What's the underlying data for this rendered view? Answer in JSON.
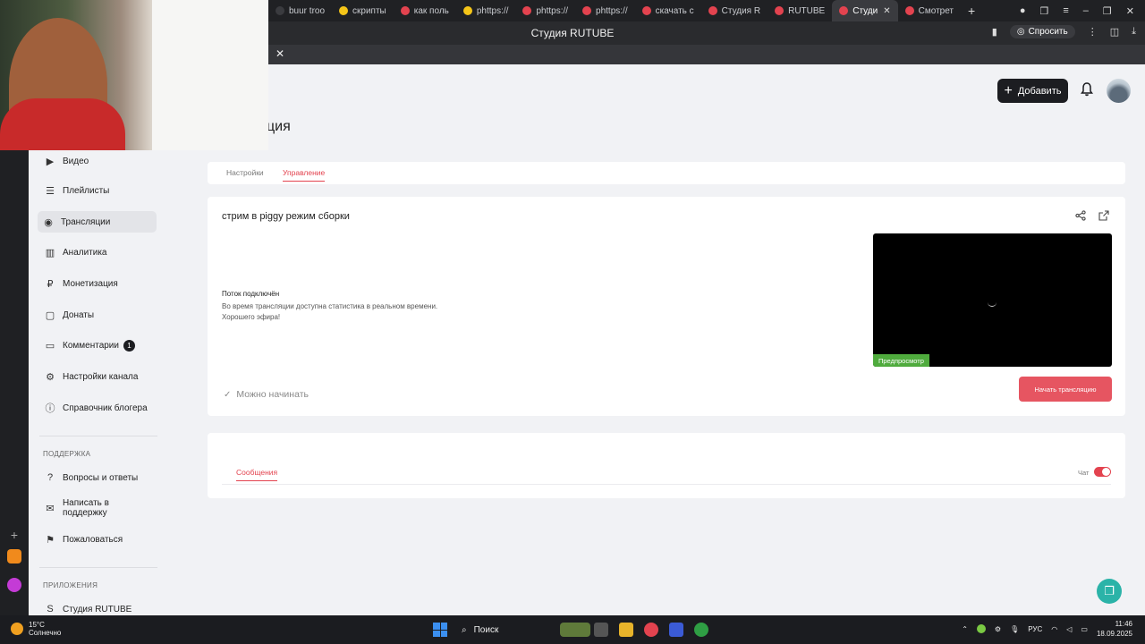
{
  "browser": {
    "tabs": [
      {
        "label": "buur troo",
        "favicon_color": "#3a3b3f"
      },
      {
        "label": "скрипты",
        "favicon_color": "#f5c518"
      },
      {
        "label": "как поль",
        "favicon_color": "#e3434f"
      },
      {
        "label": "phttps://",
        "favicon_color": "#f5c518"
      },
      {
        "label": "phttps://",
        "favicon_color": "#e3434f"
      },
      {
        "label": "phttps://",
        "favicon_color": "#e3434f"
      },
      {
        "label": "скачать с",
        "favicon_color": "#e3434f"
      },
      {
        "label": "Студия R",
        "favicon_color": "#e3434f"
      },
      {
        "label": "RUTUBE",
        "favicon_color": "#e3434f"
      },
      {
        "label": "Студи",
        "favicon_color": "#e3434f",
        "active": true
      },
      {
        "label": "Смотрет",
        "favicon_color": "#e3434f"
      }
    ],
    "page_title": "Студия RUTUBE",
    "ask_label": "Спросить"
  },
  "header": {
    "page_title_fragment": "ция",
    "add_label": "Добавить"
  },
  "sidebar": {
    "items": [
      {
        "label": "Видео",
        "icon": "video-icon",
        "glyph": "▶"
      },
      {
        "label": "Плейлисты",
        "icon": "playlist-icon",
        "glyph": "☰"
      },
      {
        "label": "Трансляции",
        "icon": "broadcast-icon",
        "glyph": "◉",
        "active": true
      },
      {
        "label": "Аналитика",
        "icon": "analytics-icon",
        "glyph": "▥"
      },
      {
        "label": "Монетизация",
        "icon": "monetization-icon",
        "glyph": "₽"
      },
      {
        "label": "Донаты",
        "icon": "donate-icon",
        "glyph": "▢"
      },
      {
        "label": "Комментарии",
        "icon": "comments-icon",
        "glyph": "▭",
        "badge": "1"
      },
      {
        "label": "Настройки канала",
        "icon": "gear-icon",
        "glyph": "⚙"
      },
      {
        "label": "Справочник блогера",
        "icon": "info-icon",
        "glyph": "ⓘ"
      }
    ],
    "support_label": "ПОДДЕРЖКА",
    "support_items": [
      {
        "label": "Вопросы и ответы",
        "icon": "faq-icon",
        "glyph": "?"
      },
      {
        "label": "Написать в поддержку",
        "icon": "mail-icon",
        "glyph": "✉"
      },
      {
        "label": "Пожаловаться",
        "icon": "flag-icon",
        "glyph": "⚑"
      }
    ],
    "apps_label": "ПРИЛОЖЕНИЯ",
    "apps_items": [
      {
        "label": "Студия RUTUBE",
        "icon": "studio-icon",
        "glyph": "S"
      }
    ]
  },
  "tabs": {
    "settings": "Настройки",
    "manage": "Управление"
  },
  "stream": {
    "name": "стрим в piggy режим сборки",
    "status_title": "Поток подключён",
    "status_line1": "Во время трансляции доступна статистика в реальном времени.",
    "status_line2": "Хорошего эфира!",
    "ready_label": "Можно начинать",
    "preview_label": "Предпросмотр",
    "start_label": "Начать трансляцию"
  },
  "chat": {
    "messages_tab": "Сообщения",
    "chat_label": "Чат",
    "chat_enabled": true
  },
  "taskbar": {
    "weather_temp": "15°C",
    "weather_desc": "Солнечно",
    "search_label": "Поиск",
    "lang": "РУС",
    "time": "11:46",
    "date": "18.09.2025"
  },
  "colors": {
    "accent": "#e3434f",
    "start_button": "#e65561",
    "preview_badge": "#4fab3d",
    "dark_button": "#1c1d21"
  }
}
